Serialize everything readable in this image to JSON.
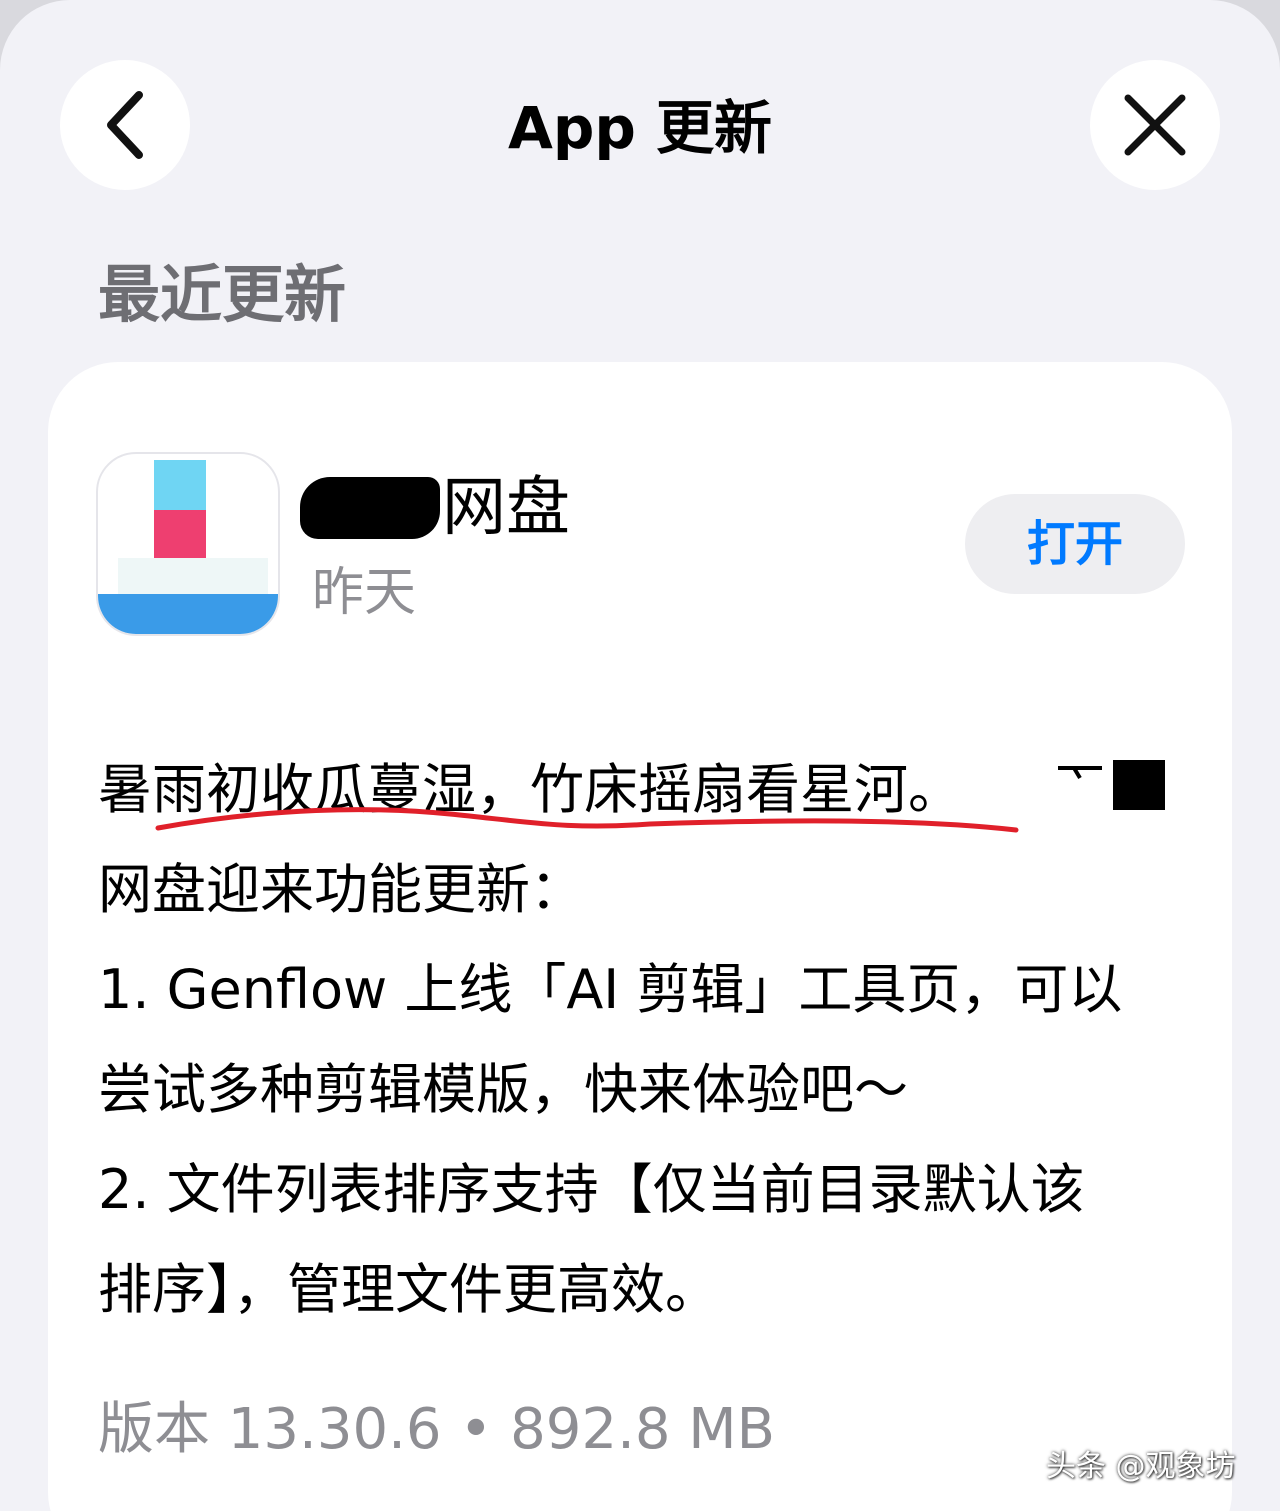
{
  "nav": {
    "title": "App 更新",
    "back_icon": "chevron-left-icon",
    "close_icon": "close-icon"
  },
  "section": {
    "title": "最近更新"
  },
  "app": {
    "name_visible": "网盘",
    "date": "昨天",
    "open_label": "打开"
  },
  "notes": {
    "lines": [
      "暑雨初收瓜蔓湿，竹床摇扇看星河。",
      "网盘迎来功能更新：",
      "1. Genflow 上线「AI 剪辑」工具页，可以",
      "尝试多种剪辑模版，快来体验吧～",
      "2. 文件列表排序支持【仅当前目录默认该",
      "排序】，管理文件更高效。"
    ]
  },
  "version": {
    "text": "版本 13.30.6 • 892.8 MB"
  },
  "watermark": "头条 @观象坊",
  "colors": {
    "accent": "#007aff",
    "background": "#f2f2f7",
    "secondary_text": "#8e8e93",
    "underline": "#e0202a"
  }
}
